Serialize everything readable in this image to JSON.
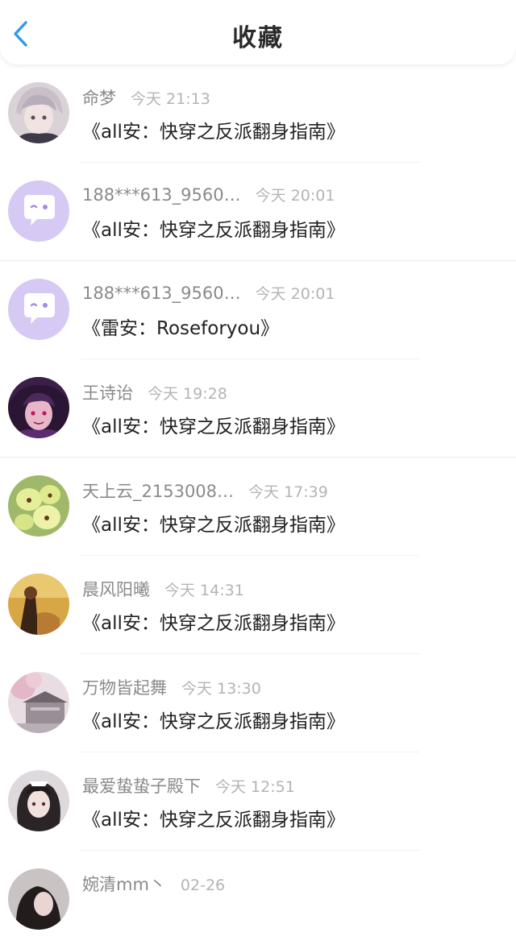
{
  "header": {
    "title": "收藏",
    "back_icon": "chevron-left-icon",
    "accent_color": "#2e9be6"
  },
  "items": [
    {
      "username": "命梦",
      "time": "今天 21:13",
      "book": "《all安：快穿之反派翻身指南》",
      "avatar": "anime-boy-avatar"
    },
    {
      "username": "188***613_9560…",
      "time": "今天 20:01",
      "book": "《all安：快穿之反派翻身指南》",
      "avatar": "default-chat-avatar"
    },
    {
      "username": "188***613_9560…",
      "time": "今天 20:01",
      "book": "《雷安：Roseforyou》",
      "avatar": "default-chat-avatar"
    },
    {
      "username": "王诗诒",
      "time": "今天 19:28",
      "book": "《all安：快穿之反派翻身指南》",
      "avatar": "anime-purple-avatar"
    },
    {
      "username": "天上云_2153008…",
      "time": "今天 17:39",
      "book": "《all安：快穿之反派翻身指南》",
      "avatar": "yellow-flower-avatar"
    },
    {
      "username": "晨风阳曦",
      "time": "今天 14:31",
      "book": "《all安：快穿之反派翻身指南》",
      "avatar": "golden-field-avatar"
    },
    {
      "username": "万物皆起舞",
      "time": "今天 13:30",
      "book": "《all安：快穿之反派翻身指南》",
      "avatar": "blossom-house-avatar"
    },
    {
      "username": "最爱蛰蛰子殿下",
      "time": "今天 12:51",
      "book": "《all安：快穿之反派翻身指南》",
      "avatar": "anime-maid-avatar"
    },
    {
      "username": "婉清mm丶",
      "time": "02-26",
      "book": "",
      "avatar": "dark-portrait-avatar"
    }
  ]
}
